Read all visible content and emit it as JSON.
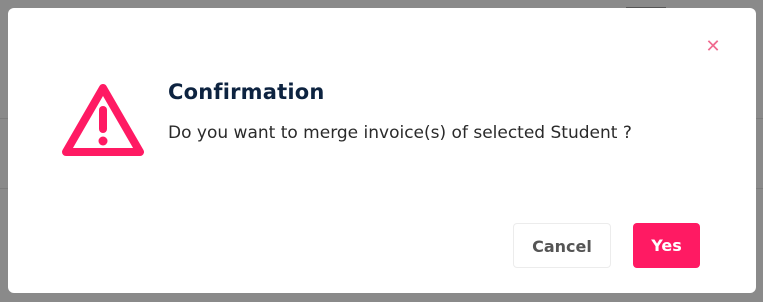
{
  "dialog": {
    "title": "Confirmation",
    "message": "Do you want to merge invoice(s) of selected Student ?",
    "close_glyph": "✕",
    "icon": "warning-triangle-icon",
    "cancel_label": "Cancel",
    "confirm_label": "Yes"
  },
  "colors": {
    "accent": "#ff1a63",
    "title": "#0d2340",
    "close": "#f06a8f"
  }
}
